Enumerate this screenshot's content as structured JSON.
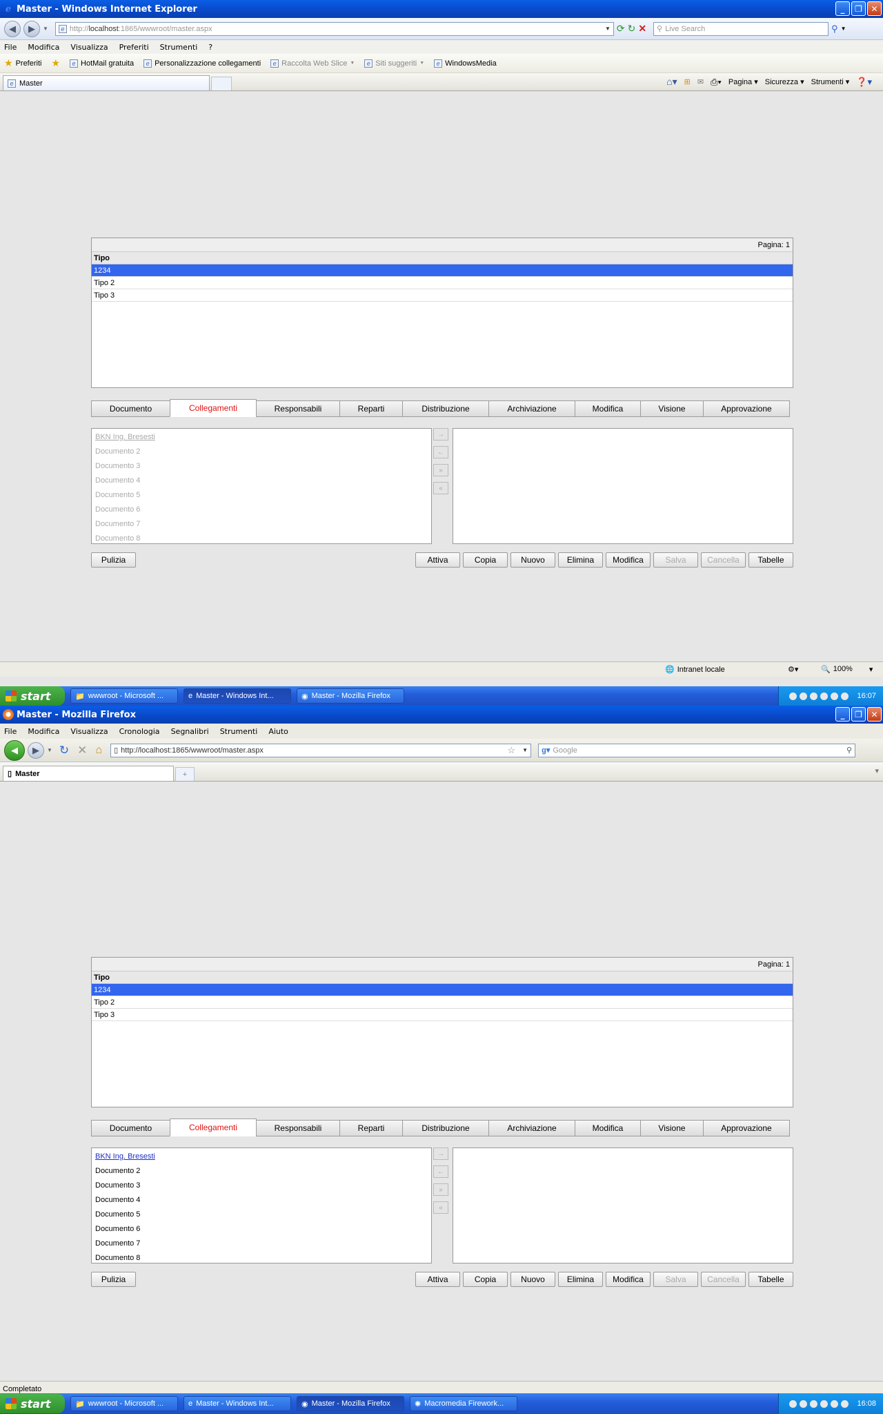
{
  "ie": {
    "title": "Master - Windows Internet Explorer",
    "address": {
      "pre": "http://",
      "host": "localhost",
      "rest": ":1865/wwwroot/master.aspx"
    },
    "search_placeholder": "Live Search",
    "menu": [
      "File",
      "Modifica",
      "Visualizza",
      "Preferiti",
      "Strumenti",
      "?"
    ],
    "favorites": {
      "label": "Preferiti",
      "items": [
        "HotMail gratuita",
        "Personalizzazione collegamenti",
        "Raccolta Web Slice",
        "Siti suggeriti",
        "WindowsMedia"
      ]
    },
    "tab_title": "Master",
    "commands": [
      "Pagina",
      "Sicurezza",
      "Strumenti"
    ],
    "status_zone": "Intranet locale",
    "zoom": "100%"
  },
  "ff": {
    "title": "Master - Mozilla Firefox",
    "address": "http://localhost:1865/wwwroot/master.aspx",
    "search_placeholder": "Google",
    "menu": [
      "File",
      "Modifica",
      "Visualizza",
      "Cronologia",
      "Segnalibri",
      "Strumenti",
      "Aiuto"
    ],
    "tab_title": "Master",
    "status": "Completato"
  },
  "app": {
    "pager": "Pagina: 1",
    "grid_header": "Tipo",
    "rows": [
      "1234",
      "Tipo 2",
      "Tipo 3"
    ],
    "tabs": [
      "Documento",
      "Collegamenti",
      "Responsabili",
      "Reparti",
      "Distribuzione",
      "Archiviazione",
      "Modifica",
      "Visione",
      "Approvazione"
    ],
    "active_tab": "Collegamenti",
    "documents": [
      "BKN Ing. Bresesti",
      "Documento 2",
      "Documento 3",
      "Documento 4",
      "Documento 5",
      "Documento 6",
      "Documento 7",
      "Documento 8"
    ],
    "clear_button": "Pulizia",
    "buttons": [
      "Attiva",
      "Copia",
      "Nuovo",
      "Elimina",
      "Modifica",
      "Salva",
      "Cancella",
      "Tabelle"
    ],
    "disabled_buttons": [
      "Salva",
      "Cancella"
    ]
  },
  "taskbar": {
    "start": "start",
    "ie_items": [
      "wwwroot - Microsoft ...",
      "Master - Windows Int...",
      "Master - Mozilla Firefox"
    ],
    "ie_time": "16:07",
    "ff_items": [
      "wwwroot - Microsoft ...",
      "Master - Windows Int...",
      "Master - Mozilla Firefox",
      "Macromedia Firework..."
    ],
    "ff_time": "16:08"
  },
  "colors": {
    "selected_row": "#3366ee",
    "active_tab_text": "#e01010",
    "link": "#1a30c8",
    "titlebar": "#0848c8",
    "taskbar": "#245edb"
  }
}
